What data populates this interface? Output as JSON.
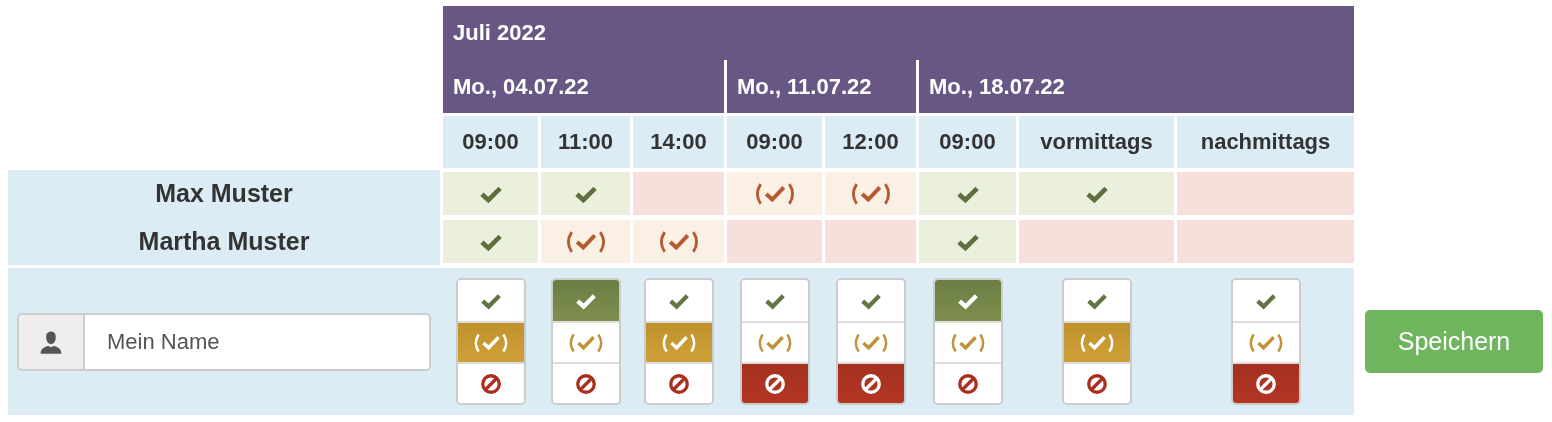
{
  "calendar": {
    "month": "Juli 2022",
    "dates": [
      {
        "label": "Mo., 04.07.22",
        "times": [
          "09:00",
          "11:00",
          "14:00"
        ]
      },
      {
        "label": "Mo., 11.07.22",
        "times": [
          "09:00",
          "12:00"
        ]
      },
      {
        "label": "Mo., 18.07.22",
        "times": [
          "09:00",
          "vormittags",
          "nachmittags"
        ]
      }
    ]
  },
  "participants": [
    {
      "name": "Max Muster",
      "answers": [
        {
          "kind": "yes"
        },
        {
          "kind": "yes"
        },
        {
          "kind": "no"
        },
        {
          "kind": "maybe"
        },
        {
          "kind": "maybe"
        },
        {
          "kind": "yes"
        },
        {
          "kind": "yes"
        },
        {
          "kind": "no"
        }
      ]
    },
    {
      "name": "Martha Muster",
      "answers": [
        {
          "kind": "yes"
        },
        {
          "kind": "maybe"
        },
        {
          "kind": "maybe"
        },
        {
          "kind": "no"
        },
        {
          "kind": "no"
        },
        {
          "kind": "yes"
        },
        {
          "kind": "no"
        },
        {
          "kind": "no"
        }
      ]
    }
  ],
  "form": {
    "name_field": {
      "placeholder": "Mein Name"
    },
    "votes": [
      {
        "options": [
          {
            "kind": "yes",
            "selected": false
          },
          {
            "kind": "maybe",
            "selected": true
          },
          {
            "kind": "no",
            "selected": false
          }
        ]
      },
      {
        "options": [
          {
            "kind": "yes",
            "selected": true
          },
          {
            "kind": "maybe",
            "selected": false
          },
          {
            "kind": "no",
            "selected": false
          }
        ]
      },
      {
        "options": [
          {
            "kind": "yes",
            "selected": false
          },
          {
            "kind": "maybe",
            "selected": true
          },
          {
            "kind": "no",
            "selected": false
          }
        ]
      },
      {
        "options": [
          {
            "kind": "yes",
            "selected": false
          },
          {
            "kind": "maybe",
            "selected": false
          },
          {
            "kind": "no",
            "selected": true
          }
        ]
      },
      {
        "options": [
          {
            "kind": "yes",
            "selected": false
          },
          {
            "kind": "maybe",
            "selected": false
          },
          {
            "kind": "no",
            "selected": true
          }
        ]
      },
      {
        "options": [
          {
            "kind": "yes",
            "selected": true
          },
          {
            "kind": "maybe",
            "selected": false
          },
          {
            "kind": "no",
            "selected": false
          }
        ]
      },
      {
        "options": [
          {
            "kind": "yes",
            "selected": false
          },
          {
            "kind": "maybe",
            "selected": true
          },
          {
            "kind": "no",
            "selected": false
          }
        ]
      },
      {
        "options": [
          {
            "kind": "yes",
            "selected": false
          },
          {
            "kind": "maybe",
            "selected": false
          },
          {
            "kind": "no",
            "selected": true
          }
        ]
      }
    ],
    "save_button": "Speichern"
  }
}
